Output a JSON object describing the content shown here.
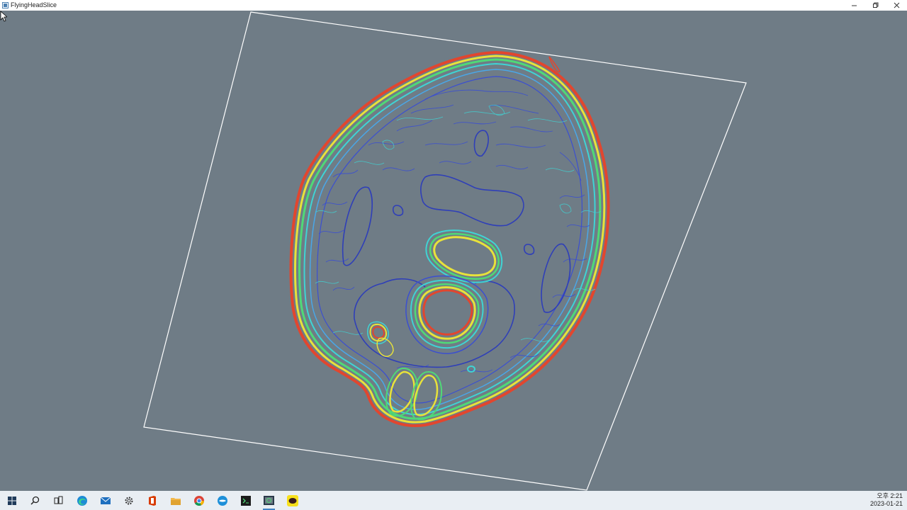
{
  "window": {
    "title": "FlyingHeadSlice",
    "controls": [
      "minimize",
      "restore",
      "close"
    ],
    "background_color": "#6f7c86"
  },
  "viewport": {
    "content": "ct-head-slice-contours",
    "frame_color": "#ffffff"
  },
  "contour_colors": {
    "outer_red": "#e2462e",
    "yellow": "#e8e23a",
    "green": "#4fd977",
    "cyan": "#3fd4d4",
    "light_blue": "#4aa7e8",
    "blue": "#3b4fd0",
    "dark_blue": "#2f3fb8"
  },
  "taskbar": {
    "icons": [
      {
        "name": "start-icon",
        "active": false
      },
      {
        "name": "search-icon",
        "active": false
      },
      {
        "name": "task-view-icon",
        "active": false
      },
      {
        "name": "edge-icon",
        "active": false
      },
      {
        "name": "mail-icon",
        "active": false
      },
      {
        "name": "settings-icon",
        "active": false
      },
      {
        "name": "office-icon",
        "active": false
      },
      {
        "name": "file-explorer-icon",
        "active": false
      },
      {
        "name": "chrome-icon",
        "active": false
      },
      {
        "name": "browser-icon",
        "active": false
      },
      {
        "name": "terminal-icon",
        "active": false
      },
      {
        "name": "flyingheadslice-app-icon",
        "active": true
      },
      {
        "name": "kakaotalk-icon",
        "active": false
      }
    ],
    "clock_time": "오후 2:21",
    "clock_date": "2023-01-21"
  }
}
